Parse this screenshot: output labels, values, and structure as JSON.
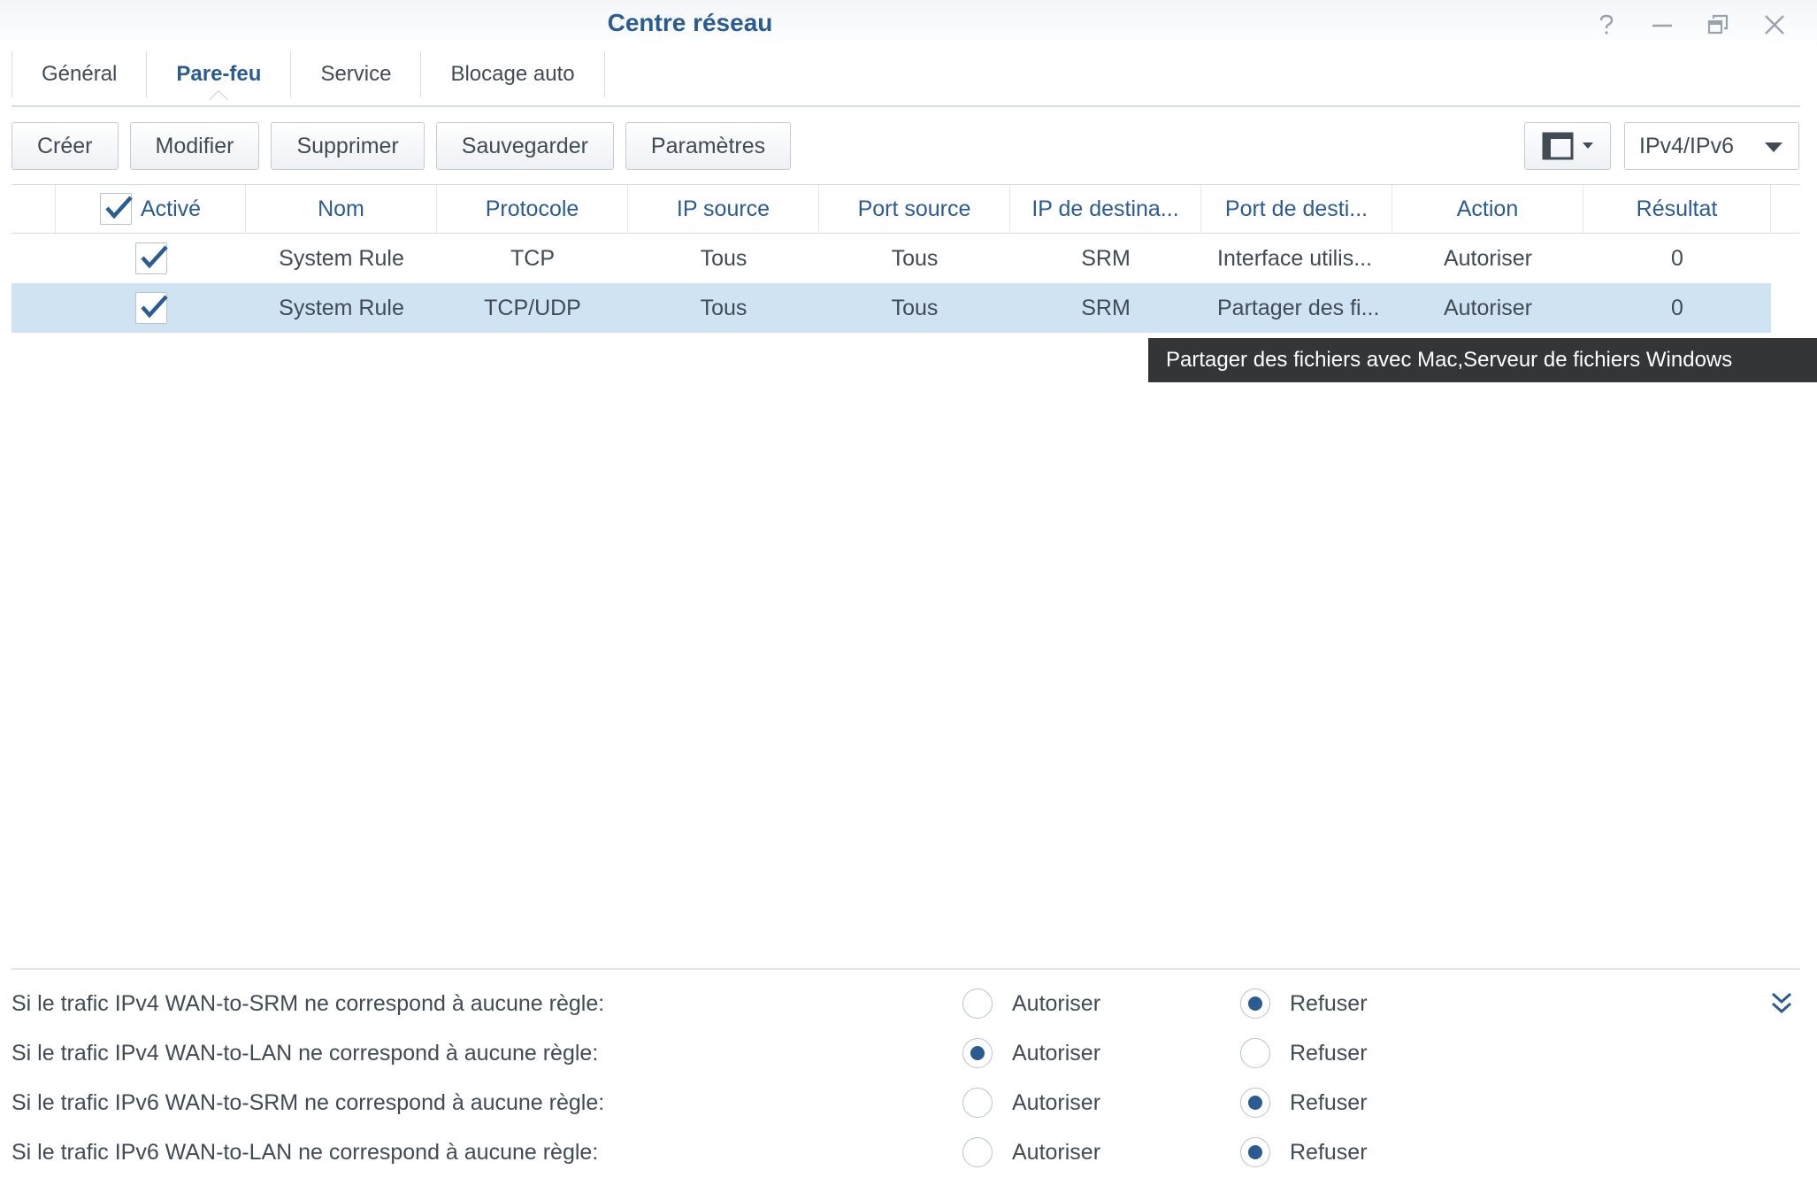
{
  "window": {
    "title": "Centre réseau",
    "controls": [
      "help-icon",
      "minimize-icon",
      "restore-icon",
      "close-icon"
    ]
  },
  "tabs": [
    {
      "label": "Général",
      "active": false
    },
    {
      "label": "Pare-feu",
      "active": true
    },
    {
      "label": "Service",
      "active": false
    },
    {
      "label": "Blocage auto",
      "active": false
    }
  ],
  "toolbar": {
    "create": "Créer",
    "modify": "Modifier",
    "delete": "Supprimer",
    "save": "Sauvegarder",
    "settings": "Paramètres",
    "view_icon": "layout-icon",
    "ip_version": "IPv4/IPv6"
  },
  "table": {
    "columns": [
      "Activé",
      "Nom",
      "Protocole",
      "IP source",
      "Port source",
      "IP de destina...",
      "Port de desti...",
      "Action",
      "Résultat"
    ],
    "rows": [
      {
        "enabled": true,
        "name": "System Rule",
        "protocol": "TCP",
        "src_ip": "Tous",
        "src_port": "Tous",
        "dst_ip": "SRM",
        "dst_port": "Interface utilis...",
        "action": "Autoriser",
        "result": "0",
        "selected": false
      },
      {
        "enabled": true,
        "name": "System Rule",
        "protocol": "TCP/UDP",
        "src_ip": "Tous",
        "src_port": "Tous",
        "dst_ip": "SRM",
        "dst_port": "Partager des fi...",
        "action": "Autoriser",
        "result": "0",
        "selected": true
      }
    ]
  },
  "tooltip": "Partager des fichiers avec Mac,Serveur de fichiers Windows",
  "policies": [
    {
      "label": "Si le trafic IPv4 WAN-to-SRM ne correspond à aucune règle:",
      "allow": "Autoriser",
      "deny": "Refuser",
      "selected": "deny"
    },
    {
      "label": "Si le trafic IPv4 WAN-to-LAN ne correspond à aucune règle:",
      "allow": "Autoriser",
      "deny": "Refuser",
      "selected": "allow"
    },
    {
      "label": "Si le trafic IPv6 WAN-to-SRM ne correspond à aucune règle:",
      "allow": "Autoriser",
      "deny": "Refuser",
      "selected": "deny"
    },
    {
      "label": "Si le trafic IPv6 WAN-to-LAN ne correspond à aucune règle:",
      "allow": "Autoriser",
      "deny": "Refuser",
      "selected": "deny"
    }
  ],
  "colors": {
    "accent": "#2a5c93",
    "selected_row": "#cfe3f3",
    "tooltip_bg": "#333537"
  }
}
